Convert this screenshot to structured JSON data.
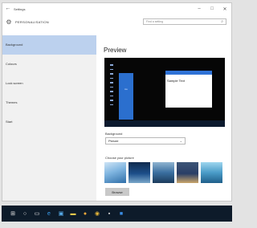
{
  "window": {
    "title": "Settings",
    "back_icon": "arrow-left-icon",
    "controls": [
      "–",
      "□",
      "✕"
    ]
  },
  "header": {
    "section_icon": "gear-icon",
    "section_title": "PERSONALISATION",
    "search_placeholder": "Find a setting"
  },
  "sidebar": {
    "items": [
      {
        "label": "Background",
        "active": true
      },
      {
        "label": "Colours",
        "active": false
      },
      {
        "label": "Lock screen",
        "active": false
      },
      {
        "label": "Themes",
        "active": false
      },
      {
        "label": "Start",
        "active": false
      }
    ]
  },
  "main": {
    "preview_title": "Preview",
    "preview_sample_text": "Sample Text",
    "preview_tile_text": "Aa",
    "background_label": "Background",
    "background_value": "Picture",
    "choose_label": "Choose your picture",
    "browse_label": "Browse",
    "thumbnail_colors": [
      "#7fb5e0",
      "#1d4f8a",
      "#3a6fa0",
      "#2a3e66",
      "#4a9cc8"
    ]
  },
  "colors": {
    "accent": "#2b6fce",
    "active_nav": "#bcd1ee",
    "taskbar": "#0d1b2a"
  },
  "taskbar": {
    "items": [
      "windows-icon",
      "search-icon",
      "task-view-icon",
      "edge-icon",
      "store-icon",
      "folder-icon",
      "mail-icon",
      "chrome-icon",
      "app-icon",
      "settings-icon"
    ]
  }
}
